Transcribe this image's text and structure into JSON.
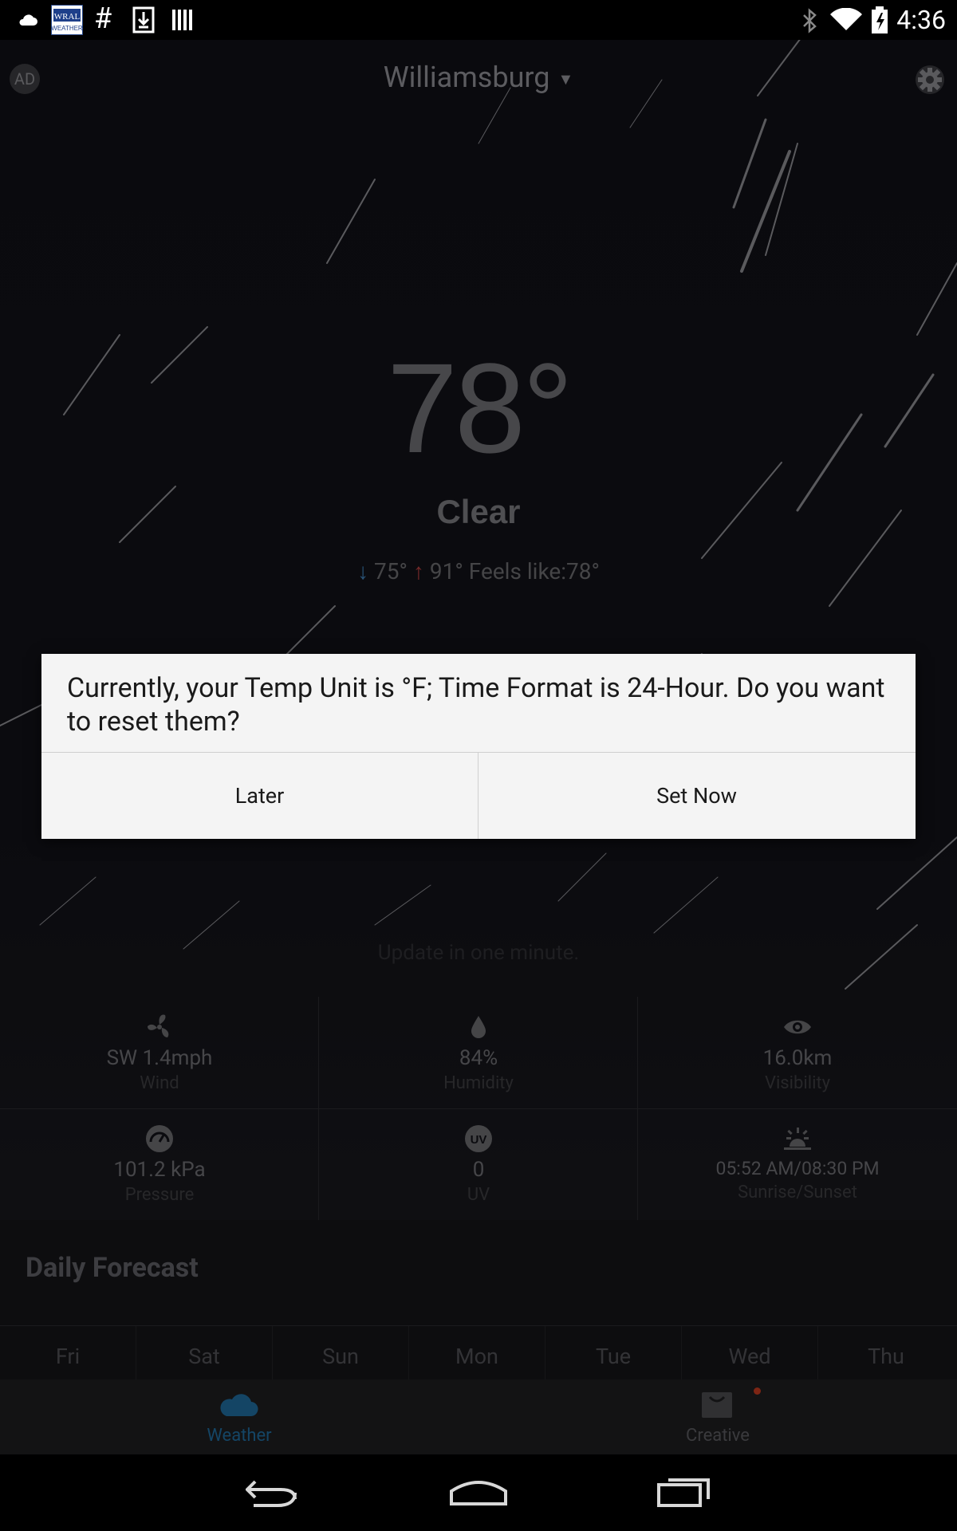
{
  "status_bar": {
    "time": "4:36"
  },
  "header": {
    "city": "Williamsburg",
    "ad_label": "AD"
  },
  "current": {
    "temperature": "78°",
    "condition": "Clear",
    "low": "75°",
    "high": "91°",
    "feels_like": "Feels like:78°",
    "update_text": "Update in one minute."
  },
  "details": [
    {
      "value": "SW  1.4mph",
      "label": "Wind",
      "icon": "fan-icon"
    },
    {
      "value": "84%",
      "label": "Humidity",
      "icon": "droplet-icon"
    },
    {
      "value": "16.0km",
      "label": "Visibility",
      "icon": "eye-icon"
    },
    {
      "value": "101.2 kPa",
      "label": "Pressure",
      "icon": "gauge-icon"
    },
    {
      "value": "0",
      "label": "UV",
      "icon": "uv-icon"
    },
    {
      "value": "05:52 AM/08:30 PM",
      "label": "Sunrise/Sunset",
      "icon": "sunrise-icon"
    }
  ],
  "daily": {
    "title": "Daily Forecast",
    "days": [
      "Fri",
      "Sat",
      "Sun",
      "Mon",
      "Tue",
      "Wed",
      "Thu"
    ]
  },
  "tabs": {
    "weather": "Weather",
    "creative": "Creative"
  },
  "dialog": {
    "message": "Currently, your Temp Unit is °F; Time Format is 24-Hour. Do you want to reset them?",
    "later": "Later",
    "set_now": "Set Now"
  },
  "colors": {
    "weather_tab": "#1f6a9c",
    "creative_tab": "#5a5a5e",
    "low_arrow": "#3f7fb5",
    "high_arrow": "#b5403f"
  }
}
